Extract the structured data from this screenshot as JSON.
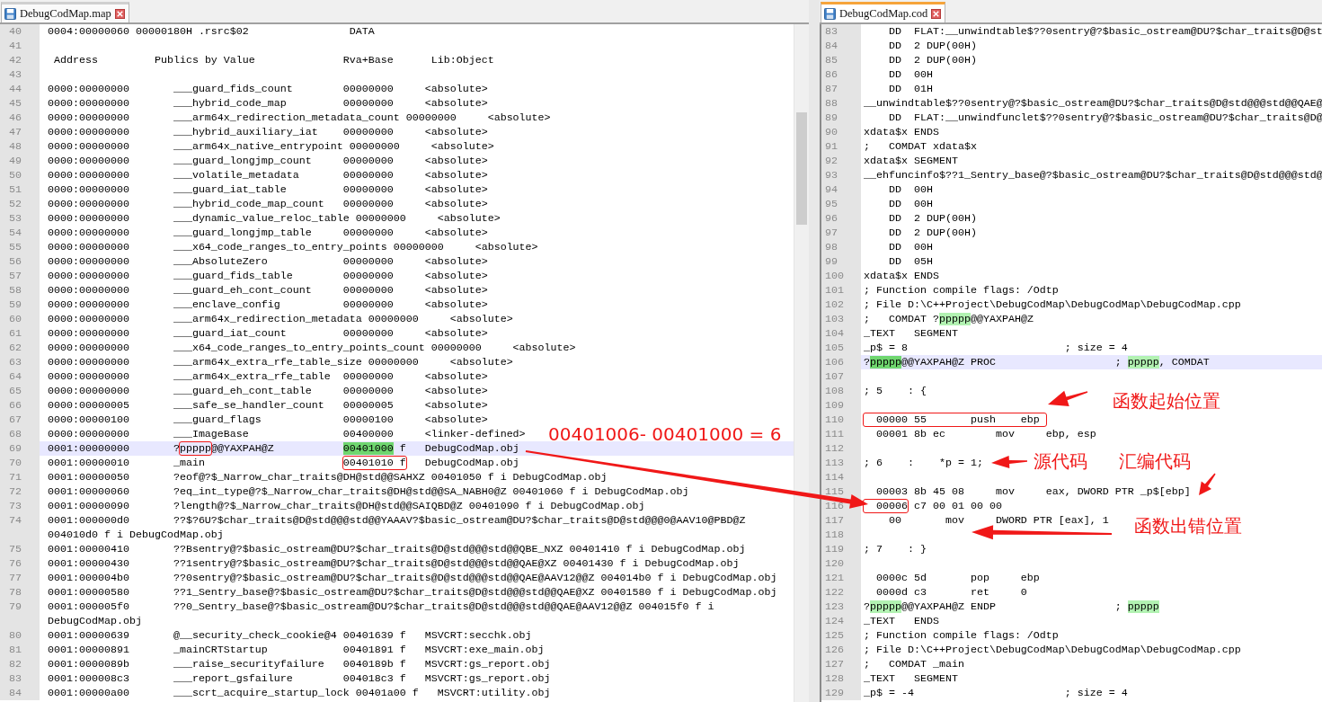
{
  "panes": [
    {
      "tab": {
        "label": "DebugCodMap.map",
        "selected": false
      },
      "vertical_scrollbar": true,
      "lines": [
        {
          "number": "40",
          "current": false,
          "text": "0004:00000060 00000180H .rsrc$02                DATA"
        },
        {
          "number": "41",
          "current": false
        },
        {
          "number": "42",
          "current": false,
          "text": " Address         Publics by Value              Rva+Base      Lib:Object"
        },
        {
          "number": "43",
          "current": false
        },
        {
          "number": "44",
          "current": false,
          "text": "0000:00000000       ___guard_fids_count        00000000     <absolute>"
        },
        {
          "number": "45",
          "current": false,
          "text": "0000:00000000       ___hybrid_code_map         00000000     <absolute>"
        },
        {
          "number": "46",
          "current": false,
          "text": "0000:00000000       ___arm64x_redirection_metadata_count 00000000     <absolute>"
        },
        {
          "number": "47",
          "current": false,
          "text": "0000:00000000       ___hybrid_auxiliary_iat    00000000     <absolute>"
        },
        {
          "number": "48",
          "current": false,
          "text": "0000:00000000       ___arm64x_native_entrypoint 00000000     <absolute>"
        },
        {
          "number": "49",
          "current": false,
          "text": "0000:00000000       ___guard_longjmp_count     00000000     <absolute>"
        },
        {
          "number": "50",
          "current": false,
          "text": "0000:00000000       ___volatile_metadata       00000000     <absolute>"
        },
        {
          "number": "51",
          "current": false,
          "text": "0000:00000000       ___guard_iat_table         00000000     <absolute>"
        },
        {
          "number": "52",
          "current": false,
          "text": "0000:00000000       ___hybrid_code_map_count   00000000     <absolute>"
        },
        {
          "number": "53",
          "current": false,
          "text": "0000:00000000       ___dynamic_value_reloc_table 00000000     <absolute>"
        },
        {
          "number": "54",
          "current": false,
          "text": "0000:00000000       ___guard_longjmp_table     00000000     <absolute>"
        },
        {
          "number": "55",
          "current": false,
          "text": "0000:00000000       ___x64_code_ranges_to_entry_points 00000000     <absolute>"
        },
        {
          "number": "56",
          "current": false,
          "text": "0000:00000000       ___AbsoluteZero            00000000     <absolute>"
        },
        {
          "number": "57",
          "current": false,
          "text": "0000:00000000       ___guard_fids_table        00000000     <absolute>"
        },
        {
          "number": "58",
          "current": false,
          "text": "0000:00000000       ___guard_eh_cont_count     00000000     <absolute>"
        },
        {
          "number": "59",
          "current": false,
          "text": "0000:00000000       ___enclave_config          00000000     <absolute>"
        },
        {
          "number": "60",
          "current": false,
          "text": "0000:00000000       ___arm64x_redirection_metadata 00000000     <absolute>"
        },
        {
          "number": "61",
          "current": false,
          "text": "0000:00000000       ___guard_iat_count         00000000     <absolute>"
        },
        {
          "number": "62",
          "current": false,
          "text": "0000:00000000       ___x64_code_ranges_to_entry_points_count 00000000     <absolute>"
        },
        {
          "number": "63",
          "current": false,
          "text": "0000:00000000       ___arm64x_extra_rfe_table_size 00000000     <absolute>"
        },
        {
          "number": "64",
          "current": false,
          "text": "0000:00000000       ___arm64x_extra_rfe_table  00000000     <absolute>"
        },
        {
          "number": "65",
          "current": false,
          "text": "0000:00000000       ___guard_eh_cont_table     00000000     <absolute>"
        },
        {
          "number": "66",
          "current": false,
          "text": "0000:00000005       ___safe_se_handler_count   00000005     <absolute>"
        },
        {
          "number": "67",
          "current": false,
          "text": "0000:00000100       ___guard_flags             00000100     <absolute>"
        },
        {
          "number": "68",
          "current": false,
          "text": "0000:00000000       ___ImageBase               00400000     <linker-defined>"
        },
        {
          "number": "69",
          "current": true,
          "segments": [
            {
              "text": "0001:00000000       ?",
              "highlighted": false,
              "selected": false,
              "framed": false
            },
            {
              "text": "ppppp",
              "highlighted": false,
              "selected": false,
              "framed": true
            },
            {
              "text": "@@YAXPAH@Z           ",
              "highlighted": false,
              "selected": false,
              "framed": false
            },
            {
              "text": "00401000",
              "highlighted": true,
              "selected": true,
              "framed": false
            },
            {
              "text": " f   DebugCodMap.obj",
              "highlighted": false,
              "selected": false,
              "framed": false
            }
          ]
        },
        {
          "number": "70",
          "current": false,
          "segments": [
            {
              "text": "0001:00000010       _main                      ",
              "highlighted": false,
              "selected": false,
              "framed": false
            },
            {
              "text": "00401010 f",
              "highlighted": false,
              "selected": false,
              "framed": true
            },
            {
              "text": "   DebugCodMap.obj",
              "highlighted": false,
              "selected": false,
              "framed": false
            }
          ]
        },
        {
          "number": "71",
          "current": false,
          "text": "0001:00000050       ?eof@?$_Narrow_char_traits@DH@std@@SAHXZ 00401050 f i DebugCodMap.obj"
        },
        {
          "number": "72",
          "current": false,
          "text": "0001:00000060       ?eq_int_type@?$_Narrow_char_traits@DH@std@@SA_NABH0@Z 00401060 f i DebugCodMap.obj"
        },
        {
          "number": "73",
          "current": false,
          "text": "0001:00000090       ?length@?$_Narrow_char_traits@DH@std@@SAIQBD@Z 00401090 f i DebugCodMap.obj"
        },
        {
          "number": "74",
          "current": false,
          "text": "0001:000000d0       ??$?6U?$char_traits@D@std@@@std@@YAAAV?$basic_ostream@DU?$char_traits@D@std@@@0@AAV10@PBD@Z 004010d0 f i DebugCodMap.obj"
        },
        {
          "number": "75",
          "current": false,
          "text": "0001:00000410       ??Bsentry@?$basic_ostream@DU?$char_traits@D@std@@@std@@QBE_NXZ 00401410 f i DebugCodMap.obj"
        },
        {
          "number": "76",
          "current": false,
          "text": "0001:00000430       ??1sentry@?$basic_ostream@DU?$char_traits@D@std@@@std@@QAE@XZ 00401430 f i DebugCodMap.obj"
        },
        {
          "number": "77",
          "current": false,
          "text": "0001:000004b0       ??0sentry@?$basic_ostream@DU?$char_traits@D@std@@@std@@QAE@AAV12@@Z 004014b0 f i DebugCodMap.obj"
        },
        {
          "number": "78",
          "current": false,
          "text": "0001:00000580       ??1_Sentry_base@?$basic_ostream@DU?$char_traits@D@std@@@std@@QAE@XZ 00401580 f i DebugCodMap.obj"
        },
        {
          "number": "79",
          "current": false,
          "text": "0001:000005f0       ??0_Sentry_base@?$basic_ostream@DU?$char_traits@D@std@@@std@@QAE@AAV12@@Z 004015f0 f i DebugCodMap.obj"
        },
        {
          "number": "80",
          "current": false,
          "text": "0001:00000639       @__security_check_cookie@4 00401639 f   MSVCRT:secchk.obj"
        },
        {
          "number": "81",
          "current": false,
          "text": "0001:00000891       _mainCRTStartup            00401891 f   MSVCRT:exe_main.obj"
        },
        {
          "number": "82",
          "current": false,
          "text": "0001:0000089b       ___raise_securityfailure   0040189b f   MSVCRT:gs_report.obj"
        },
        {
          "number": "83",
          "current": false,
          "text": "0001:000008c3       ___report_gsfailure        004018c3 f   MSVCRT:gs_report.obj"
        },
        {
          "number": "84",
          "current": false,
          "text": "0001:00000a00       ___scrt_acquire_startup_lock 00401a00 f   MSVCRT:utility.obj"
        }
      ]
    },
    {
      "tab": {
        "label": "DebugCodMap.cod",
        "selected": true
      },
      "vertical_scrollbar": false,
      "lines": [
        {
          "number": "83",
          "current": false,
          "text": "    DD  FLAT:__unwindtable$??0sentry@?$basic_ostream@DU?$char_traits@D@st"
        },
        {
          "number": "84",
          "current": false,
          "text": "    DD  2 DUP(00H)"
        },
        {
          "number": "85",
          "current": false,
          "text": "    DD  2 DUP(00H)"
        },
        {
          "number": "86",
          "current": false,
          "text": "    DD  00H"
        },
        {
          "number": "87",
          "current": false,
          "text": "    DD  01H"
        },
        {
          "number": "88",
          "current": false,
          "text": "__unwindtable$??0sentry@?$basic_ostream@DU?$char_traits@D@std@@@std@@QAE@"
        },
        {
          "number": "89",
          "current": false,
          "text": "    DD  FLAT:__unwindfunclet$??0sentry@?$basic_ostream@DU?$char_traits@D@"
        },
        {
          "number": "90",
          "current": false,
          "text": "xdata$x ENDS"
        },
        {
          "number": "91",
          "current": false,
          "text": ";   COMDAT xdata$x"
        },
        {
          "number": "92",
          "current": false,
          "text": "xdata$x SEGMENT"
        },
        {
          "number": "93",
          "current": false,
          "text": "__ehfuncinfo$??1_Sentry_base@?$basic_ostream@DU?$char_traits@D@std@@@std@"
        },
        {
          "number": "94",
          "current": false,
          "text": "    DD  00H"
        },
        {
          "number": "95",
          "current": false,
          "text": "    DD  00H"
        },
        {
          "number": "96",
          "current": false,
          "text": "    DD  2 DUP(00H)"
        },
        {
          "number": "97",
          "current": false,
          "text": "    DD  2 DUP(00H)"
        },
        {
          "number": "98",
          "current": false,
          "text": "    DD  00H"
        },
        {
          "number": "99",
          "current": false,
          "text": "    DD  05H"
        },
        {
          "number": "100",
          "current": false,
          "text": "xdata$x ENDS"
        },
        {
          "number": "101",
          "current": false,
          "text": "; Function compile flags: /Odtp"
        },
        {
          "number": "102",
          "current": false,
          "text": "; File D:\\C++Project\\DebugCodMap\\DebugCodMap\\DebugCodMap.cpp"
        },
        {
          "number": "103",
          "current": false,
          "segments": [
            {
              "text": ";   COMDAT ?",
              "highlighted": false,
              "selected": false
            },
            {
              "text": "ppppp",
              "highlighted": true,
              "selected": false
            },
            {
              "text": "@@YAXPAH@Z",
              "highlighted": false,
              "selected": false
            }
          ]
        },
        {
          "number": "104",
          "current": false,
          "text": "_TEXT   SEGMENT"
        },
        {
          "number": "105",
          "current": false,
          "text": "_p$ = 8                         ; size = 4"
        },
        {
          "number": "106",
          "current": true,
          "segments": [
            {
              "text": "?",
              "highlighted": false,
              "selected": false
            },
            {
              "text": "ppppp",
              "highlighted": true,
              "selected": true
            },
            {
              "text": "@@YAXPAH@Z PROC                   ; ",
              "highlighted": false,
              "selected": false
            },
            {
              "text": "ppppp",
              "highlighted": true,
              "selected": false
            },
            {
              "text": ", COMDAT",
              "highlighted": false,
              "selected": false
            }
          ]
        },
        {
          "number": "107",
          "current": false
        },
        {
          "number": "108",
          "current": false,
          "text": "; 5    : {"
        },
        {
          "number": "109",
          "current": false
        },
        {
          "number": "110",
          "current": false,
          "segments": [
            {
              "text": "  00000 55       push    ebp ",
              "highlighted": false,
              "selected": false,
              "framed": true
            }
          ]
        },
        {
          "number": "111",
          "current": false,
          "text": "  00001 8b ec        mov     ebp, esp"
        },
        {
          "number": "112",
          "current": false
        },
        {
          "number": "113",
          "current": false,
          "text": "; 6    :    *p = 1;"
        },
        {
          "number": "114",
          "current": false
        },
        {
          "number": "115",
          "current": false,
          "text": "  00003 8b 45 08     mov     eax, DWORD PTR _p$[ebp]"
        },
        {
          "number": "116",
          "current": false,
          "segments": [
            {
              "text": "  00006",
              "highlighted": false,
              "selected": false,
              "framed": true
            },
            {
              "text": " c7 00 01 00 00",
              "highlighted": false,
              "selected": false,
              "framed": false
            }
          ]
        },
        {
          "number": "117",
          "current": false,
          "text": "    00       mov     DWORD PTR [eax], 1"
        },
        {
          "number": "118",
          "current": false
        },
        {
          "number": "119",
          "current": false,
          "text": "; 7    : }"
        },
        {
          "number": "120",
          "current": false
        },
        {
          "number": "121",
          "current": false,
          "text": "  0000c 5d       pop     ebp"
        },
        {
          "number": "122",
          "current": false,
          "text": "  0000d c3       ret     0"
        },
        {
          "number": "123",
          "current": false,
          "segments": [
            {
              "text": "?",
              "highlighted": false,
              "selected": false
            },
            {
              "text": "ppppp",
              "highlighted": true,
              "selected": false
            },
            {
              "text": "@@YAXPAH@Z ENDP                   ; ",
              "highlighted": false,
              "selected": false
            },
            {
              "text": "ppppp",
              "highlighted": true,
              "selected": false
            }
          ]
        },
        {
          "number": "124",
          "current": false,
          "text": "_TEXT   ENDS"
        },
        {
          "number": "125",
          "current": false,
          "text": "; Function compile flags: /Odtp"
        },
        {
          "number": "126",
          "current": false,
          "text": "; File D:\\C++Project\\DebugCodMap\\DebugCodMap\\DebugCodMap.cpp"
        },
        {
          "number": "127",
          "current": false,
          "text": ";   COMDAT _main"
        },
        {
          "number": "128",
          "current": false,
          "text": "_TEXT   SEGMENT"
        },
        {
          "number": "129",
          "current": false,
          "text": "_p$ = -4                        ; size = 4"
        }
      ]
    }
  ],
  "annotations": [
    {
      "text": "00401006- 00401000 = 6"
    },
    {
      "text": "函数起始位置"
    },
    {
      "text": "源代码"
    },
    {
      "text": "汇编代码"
    },
    {
      "text": "函数出错位置"
    }
  ]
}
